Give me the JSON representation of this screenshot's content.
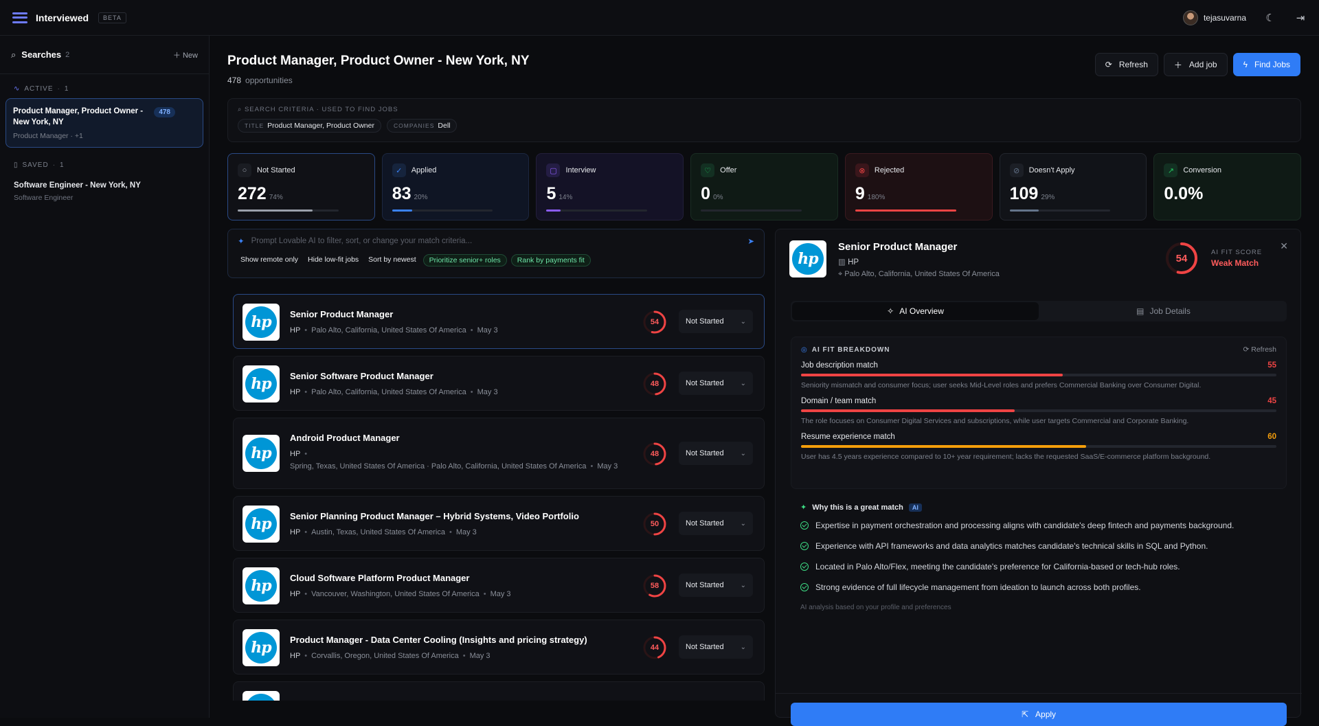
{
  "app": {
    "title": "Interviewed",
    "beta": "BETA",
    "user": "tejasuvarna"
  },
  "sidebar": {
    "title": "Searches",
    "count": "2",
    "new_label": "New",
    "active_label": "ACTIVE",
    "active_count": "1",
    "active_search": {
      "name": "Product Manager, Product Owner - New York, NY",
      "sub": "Product Manager · +1",
      "badge": "478"
    },
    "saved_label": "SAVED",
    "saved_count": "1",
    "saved_search": {
      "name": "Software Engineer - New York, NY",
      "sub": "Software Engineer"
    }
  },
  "header": {
    "title": "Product Manager, Product Owner - New York, NY",
    "count": "478",
    "count_label": "opportunities",
    "refresh": "Refresh",
    "add_job": "Add job",
    "find_jobs": "Find Jobs"
  },
  "criteria": {
    "label": "SEARCH CRITERIA · USED TO FIND JOBS",
    "title_key": "TITLE",
    "title_val": "Product Manager, Product Owner",
    "companies_key": "COMPANIES",
    "companies_val": "Dell"
  },
  "stats": [
    {
      "label": "Not Started",
      "value": "272",
      "pct": "74%",
      "fill": 0.74,
      "color": "#9aa0aa",
      "bg": "#101116",
      "border": "#2a4a86",
      "icbg": "#1a1c22"
    },
    {
      "label": "Applied",
      "value": "83",
      "pct": "20%",
      "fill": 0.2,
      "color": "#3b82f6",
      "bg": "#0f1524",
      "border": "#1c2740",
      "icbg": "#16243d"
    },
    {
      "label": "Interview",
      "value": "5",
      "pct": "14%",
      "fill": 0.14,
      "color": "#8b5cf6",
      "bg": "#141226",
      "border": "#231f3a",
      "icbg": "#241d44"
    },
    {
      "label": "Offer",
      "value": "0",
      "pct": "0%",
      "fill": 0.0,
      "color": "#22c55e",
      "bg": "#0f1a15",
      "border": "#1a2d23",
      "icbg": "#133022"
    },
    {
      "label": "Rejected",
      "value": "9",
      "pct": "180%",
      "fill": 1.0,
      "color": "#ef4444",
      "bg": "#1d1013",
      "border": "#3a1a1f",
      "icbg": "#3a161b"
    },
    {
      "label": "Doesn't Apply",
      "value": "109",
      "pct": "29%",
      "fill": 0.29,
      "color": "#64748b",
      "bg": "#111318",
      "border": "#23262e",
      "icbg": "#1c1f26"
    },
    {
      "label": "Conversion",
      "value": "0.0%",
      "pct": "",
      "fill": 0.0,
      "color": "#22c55e",
      "bg": "#0f1a15",
      "border": "#1a2d23",
      "icbg": "#133022"
    }
  ],
  "prompt": {
    "placeholder": "Prompt Lovable AI to filter, sort, or change your match criteria...",
    "chips": [
      "Show remote only",
      "Hide low-fit jobs",
      "Sort by newest",
      "Prioritize senior+ roles",
      "Rank by payments fit"
    ]
  },
  "jobs": [
    {
      "title": "Senior Product Manager",
      "company": "HP",
      "location": "Palo Alto, California, United States Of America",
      "date": "May 3",
      "score": 54,
      "status": "Not Started"
    },
    {
      "title": "Senior Software Product Manager",
      "company": "HP",
      "location": "Palo Alto, California, United States Of America",
      "date": "May 3",
      "score": 48,
      "status": "Not Started"
    },
    {
      "title": "Android Product Manager",
      "company": "HP",
      "location": "Spring, Texas, United States Of America · Palo Alto, California, United States Of America",
      "date": "May 3",
      "score": 48,
      "status": "Not Started"
    },
    {
      "title": "Senior Planning Product Manager – Hybrid Systems, Video Portfolio",
      "company": "HP",
      "location": "Austin, Texas, United States Of America",
      "date": "May 3",
      "score": 50,
      "status": "Not Started"
    },
    {
      "title": "Cloud Software Platform Product Manager",
      "company": "HP",
      "location": "Vancouver, Washington, United States Of America",
      "date": "May 3",
      "score": 58,
      "status": "Not Started"
    },
    {
      "title": "Product Manager - Data Center Cooling (Insights and pricing strategy)",
      "company": "HP",
      "location": "Corvallis, Oregon, United States Of America",
      "date": "May 3",
      "score": 44,
      "status": "Not Started"
    }
  ],
  "detail": {
    "title": "Senior Product Manager",
    "company": "HP",
    "location": "Palo Alto, California, United States Of America",
    "score": 54,
    "fit_label": "AI FIT SCORE",
    "fit_verdict": "Weak Match",
    "tab_overview": "AI Overview",
    "tab_details": "Job Details",
    "breakdown_title": "AI FIT BREAKDOWN",
    "breakdown_refresh": "Refresh",
    "criteria": [
      {
        "name": "Job description match",
        "score": 55,
        "color": "#ef4444",
        "desc": "Seniority mismatch and consumer focus; user seeks Mid-Level roles and prefers Commercial Banking over Consumer Digital."
      },
      {
        "name": "Domain / team match",
        "score": 45,
        "color": "#ef4444",
        "desc": "The role focuses on Consumer Digital Services and subscriptions, while user targets Commercial and Corporate Banking."
      },
      {
        "name": "Resume experience match",
        "score": 60,
        "color": "#f59e0b",
        "desc": "User has 4.5 years experience compared to 10+ year requirement; lacks the requested SaaS/E-commerce platform background."
      }
    ],
    "why_title": "Why this is a great match",
    "why_ai": "AI",
    "reasons": [
      "Expertise in payment orchestration and processing aligns with candidate's deep fintech and payments background.",
      "Experience with API frameworks and data analytics matches candidate's technical skills in SQL and Python.",
      "Located in Palo Alto/Flex, meeting the candidate's preference for California-based or tech-hub roles.",
      "Strong evidence of full lifecycle management from ideation to launch across both profiles."
    ],
    "footnote": "AI analysis based on your profile and preferences",
    "apply": "Apply"
  }
}
